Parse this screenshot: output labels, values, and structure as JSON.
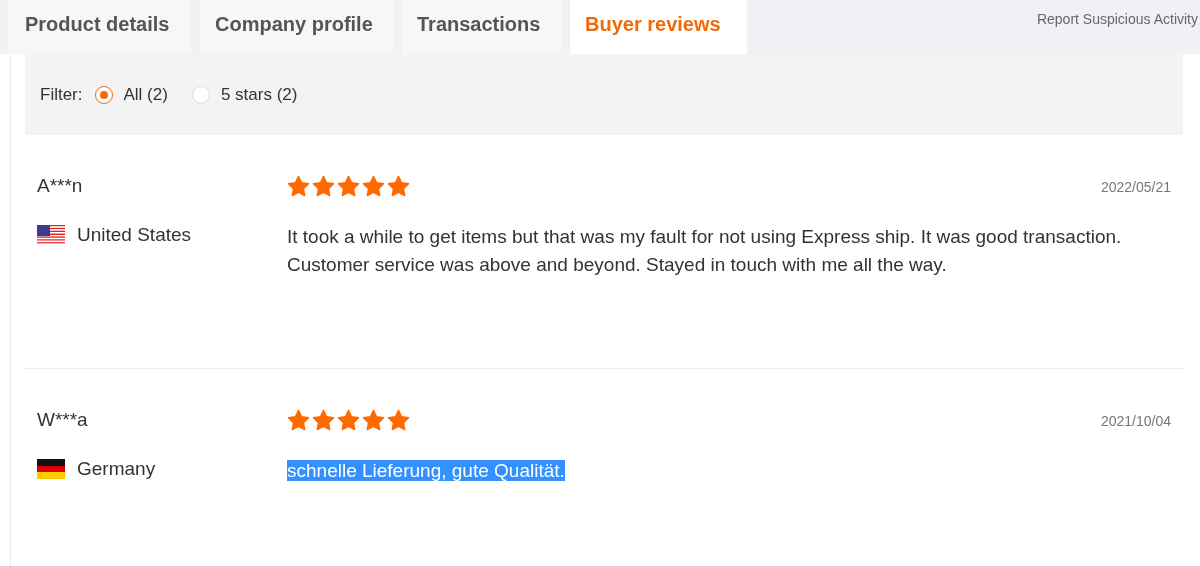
{
  "tabs": [
    {
      "label": "Product details",
      "selected": false
    },
    {
      "label": "Company profile",
      "selected": false
    },
    {
      "label": "Transactions",
      "selected": false
    },
    {
      "label": "Buyer reviews",
      "selected": true
    }
  ],
  "report_link": "Report Suspicious Activity",
  "filter": {
    "label": "Filter:",
    "options": [
      {
        "label": "All (2)",
        "selected": true
      },
      {
        "label": "5 stars (2)",
        "selected": false
      }
    ]
  },
  "reviews": [
    {
      "buyer": "A***n",
      "kind": "us",
      "country": "United States",
      "stars": 5,
      "date": "2022/05/21",
      "text": "It took a while to get items but that was my fault for not using Express ship. It was good transaction. Customer service was above and beyond. Stayed in touch with me all the way.",
      "highlighted": false
    },
    {
      "buyer": "W***a",
      "kind": "de",
      "country": "Germany",
      "stars": 5,
      "date": "2021/10/04",
      "text": "schnelle Lieferung, gute Qualität.",
      "highlighted": true
    }
  ]
}
